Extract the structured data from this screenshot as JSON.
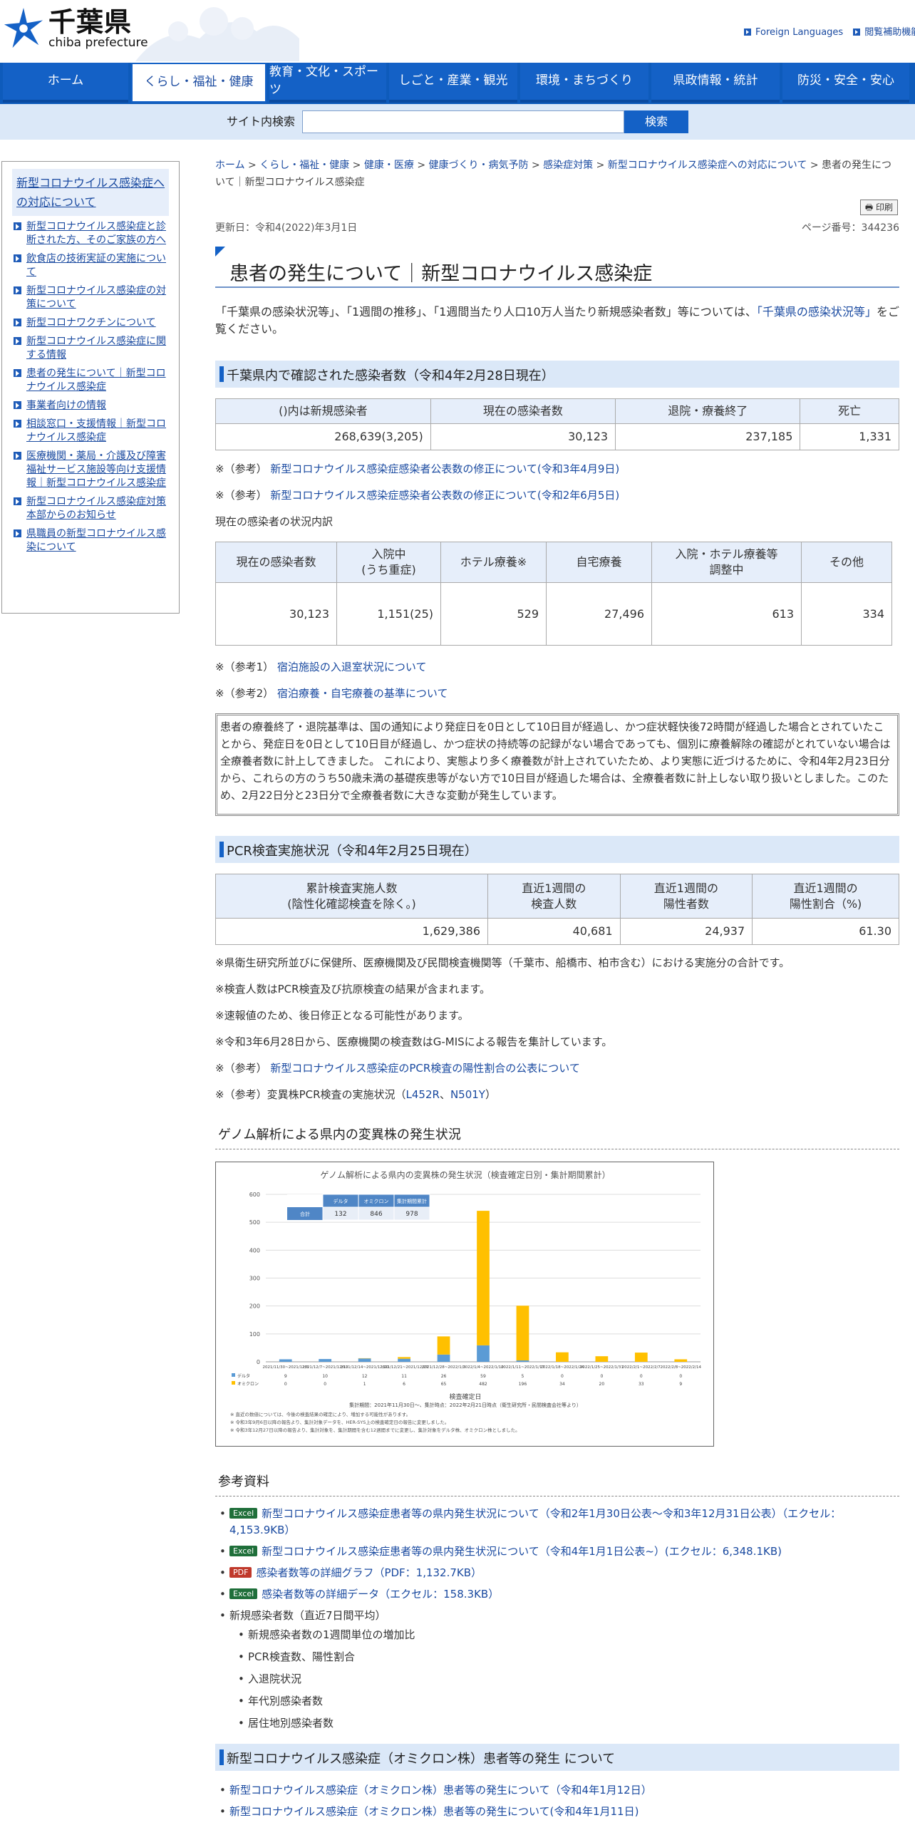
{
  "header": {
    "logo_ja": "千葉県",
    "logo_en": "chiba prefecture",
    "links": [
      "Foreign Languages",
      "閲覧補助機能"
    ]
  },
  "gnav": [
    {
      "label": "ホーム",
      "active": false
    },
    {
      "label": "くらし・福祉・健康",
      "active": true
    },
    {
      "label": "教育・文化・スポーツ",
      "active": false
    },
    {
      "label": "しごと・産業・観光",
      "active": false
    },
    {
      "label": "環境・まちづくり",
      "active": false
    },
    {
      "label": "県政情報・統計",
      "active": false
    },
    {
      "label": "防災・安全・安心",
      "active": false
    }
  ],
  "search": {
    "label": "サイト内検索",
    "button": "検索",
    "value": ""
  },
  "sidebar": {
    "title": "新型コロナウイルス感染症への対応について",
    "items": [
      "新型コロナウイルス感染症と診断された方、そのご家族の方へ",
      "飲食店の技術実証の実施について",
      "新型コロナウイルス感染症の対策について",
      "新型コロナワクチンについて",
      "新型コロナウイルス感染症に関する情報",
      "患者の発生について｜新型コロナウイルス感染症",
      "事業者向けの情報",
      "相談窓口・支援情報｜新型コロナウイルス感染症",
      "医療機関・薬局・介護及び障害福祉サービス施設等向け支援情報｜新型コロナウイルス感染症",
      "新型コロナウイルス感染症対策本部からのお知らせ",
      "県職員の新型コロナウイルス感染について"
    ]
  },
  "breadcrumb": {
    "links": [
      "ホーム",
      "くらし・福祉・健康",
      "健康・医療",
      "健康づくり・病気予防",
      "感染症対策",
      "新型コロナウイルス感染症への対応について"
    ],
    "current": "患者の発生について｜新型コロナウイルス感染症",
    "sep": " > "
  },
  "print_label": "印刷",
  "updated": "更新日：令和4(2022)年3月1日",
  "page_no": "ページ番号：344236",
  "title": "患者の発生について｜新型コロナウイルス感染症",
  "intro": {
    "text": "「千葉県の感染状況等」、「1週間の推移」、「1週間当たり人口10万人当たり新規感染者数」等については、",
    "link": "「千葉県の感染状況等」",
    "tail": "をご覧ください。"
  },
  "sec1": {
    "heading": "千葉県内で確認された感染者数（令和4年2月28日現在）",
    "headers": [
      "()内は新規感染者",
      "現在の感染者数",
      "退院・療養終了",
      "死亡"
    ],
    "values": [
      "268,639(3,205)",
      "30,123",
      "237,185",
      "1,331"
    ],
    "refs": [
      {
        "prefix": "※（参考）",
        "link": "新型コロナウイルス感染症感染者公表数の修正について(令和3年4月9日)"
      },
      {
        "prefix": "※（参考）",
        "link": "新型コロナウイルス感染症感染者公表数の修正について(令和2年6月5日)"
      }
    ],
    "breakdown_label": "現在の感染者の状況内訳",
    "b_headers": [
      "現在の感染者数",
      "入院中\n(うち重症)",
      "ホテル療養※",
      "自宅療養",
      "入院・ホテル療養等\n調整中",
      "その他"
    ],
    "b_values": [
      "30,123",
      "1,151(25)",
      "529",
      "27,496",
      "613",
      "334"
    ],
    "refs2": [
      {
        "prefix": "※（参考1）",
        "link": "宿泊施設の入退室状況について"
      },
      {
        "prefix": "※（参考2）",
        "link": "宿泊療養・自宅療養の基準について"
      }
    ],
    "note": "患者の療養終了・退院基準は、国の通知により発症日を0日として10日目が経過し、かつ症状軽快後72時間が経過した場合とされていたことから、発症日を0日として10日目が経過し、かつ症状の持続等の記録がない場合であっても、個別に療養解除の確認がとれていない場合は全療養者数に計上してきました。 これにより、実態より多く療養数が計上されていたため、より実態に近づけるために、令和4年2月23日分から、これらの方のうち50歳未満の基礎疾患等がない方で10日目が経過した場合は、全療養者数に計上しない取り扱いとしました。このため、2月22日分と23日分で全療養者数に大きな変動が発生しています。"
  },
  "sec2": {
    "heading": "PCR検査実施状況（令和4年2月25日現在）",
    "headers": [
      "累計検査実施人数\n(陰性化確認検査を除く。)",
      "直近1週間の\n検査人数",
      "直近1週間の\n陽性者数",
      "直近1週間の\n陽性割合（%)"
    ],
    "values": [
      "1,629,386",
      "40,681",
      "24,937",
      "61.30"
    ],
    "notes": [
      "※県衛生研究所並びに保健所、医療機関及び民間検査機関等（千葉市、船橋市、柏市含む）における実施分の合計です。",
      "※検査人数はPCR検査及び抗原検査の結果が含まれます。",
      "※速報値のため、後日修正となる可能性があります。",
      "※令和3年6月28日から、医療機関の検査数はG-MISによる報告を集計しています。"
    ],
    "ref_prefix": "※（参考）",
    "ref_link": "新型コロナウイルス感染症のPCR検査の陽性割合の公表について",
    "variant_prefix": "※（参考）変異株PCR検査の実施状況（",
    "variant_links": [
      "L452R",
      "N501Y"
    ],
    "variant_sep": "、",
    "variant_tail": "）"
  },
  "sec3": {
    "heading": "ゲノム解析による県内の変異株の発生状況"
  },
  "chart_data": {
    "type": "bar",
    "title": "ゲノム解析による県内の変異株の発生状況（検査確定日別・集計期間累計）",
    "xlabel": "検査確定日",
    "categories": [
      "2021/11/30~2021/12/6",
      "2021/12/7~2021/12/13",
      "2021/12/14~2021/12/20",
      "2021/12/21~2021/12/27",
      "2021/12/28~2022/1/3",
      "2022/1/4~2022/1/10",
      "2022/1/11~2022/1/17",
      "2022/1/18~2022/1/24",
      "2022/1/25~2022/1/31",
      "2022/2/1~2022/2/7",
      "2022/2/8~2022/2/14"
    ],
    "series": [
      {
        "name": "デルタ",
        "values": [
          9,
          10,
          12,
          11,
          26,
          59,
          5,
          0,
          0,
          0,
          0
        ],
        "color": "#5b9bd5"
      },
      {
        "name": "オミクロン",
        "values": [
          0,
          0,
          1,
          6,
          65,
          482,
          196,
          34,
          20,
          33,
          9
        ],
        "color": "#ffc000"
      }
    ],
    "ylim": [
      0,
      600
    ],
    "yticks": [
      0,
      100,
      200,
      300,
      400,
      500,
      600
    ],
    "summary_headers": [
      "デルタ",
      "オミクロン",
      "集計期間累計"
    ],
    "summary_row_label": "合計",
    "summary_values": [
      "132",
      "846",
      "978"
    ],
    "footnote_line": "集計期間：2021年11月30日～、集計時点：2022年2月21日時点（衛生研究所・民間検査会社等より）",
    "footnotes": [
      "※ 直近の数値については、今後の検査結果の確定により、増加する可能性があります。",
      "※ 令和3年9月6日以降の報告より、集計対象データを、HER-SYS上の検査確定日の報告に変更しました。",
      "※ 令和3年12月27日以降の報告より、集計対象を、集計期間を含む12週間までに変更し、集計対象をデルタ株、オミクロン株としました。"
    ]
  },
  "sec4": {
    "heading": "参考資料",
    "items": [
      {
        "badge": "Excel",
        "color": "#1f6f3a",
        "text": "新型コロナウイルス感染症患者等の県内発生状況について（令和2年1月30日公表～令和3年12月31日公表）（エクセル：4,153.9KB）"
      },
      {
        "badge": "Excel",
        "color": "#1f6f3a",
        "text": "新型コロナウイルス感染症患者等の県内発生状況について（令和4年1月1日公表~）(エクセル：6,348.1KB)"
      },
      {
        "badge": "PDF",
        "color": "#c0392b",
        "text": "感染者数等の詳細グラフ（PDF：1,132.7KB）"
      },
      {
        "badge": "Excel",
        "color": "#1f6f3a",
        "text": "感染者数等の詳細データ（エクセル：158.3KB）"
      }
    ],
    "plain": "新規感染者数（直近7日間平均）",
    "sub": [
      "新規感染者数の1週間単位の増加比",
      "PCR検査数、陽性割合",
      "入退院状況",
      "年代別感染者数",
      "居住地別感染者数"
    ]
  },
  "sec5": {
    "heading": "新型コロナウイルス感染症（オミクロン株）患者等の発生 について",
    "links": [
      "新型コロナウイルス感染症（オミクロン株）患者等の発生について（令和4年1月12日）",
      "新型コロナウイルス感染症（オミクロン株）患者等の発生について(令和4年1月11日)"
    ]
  }
}
